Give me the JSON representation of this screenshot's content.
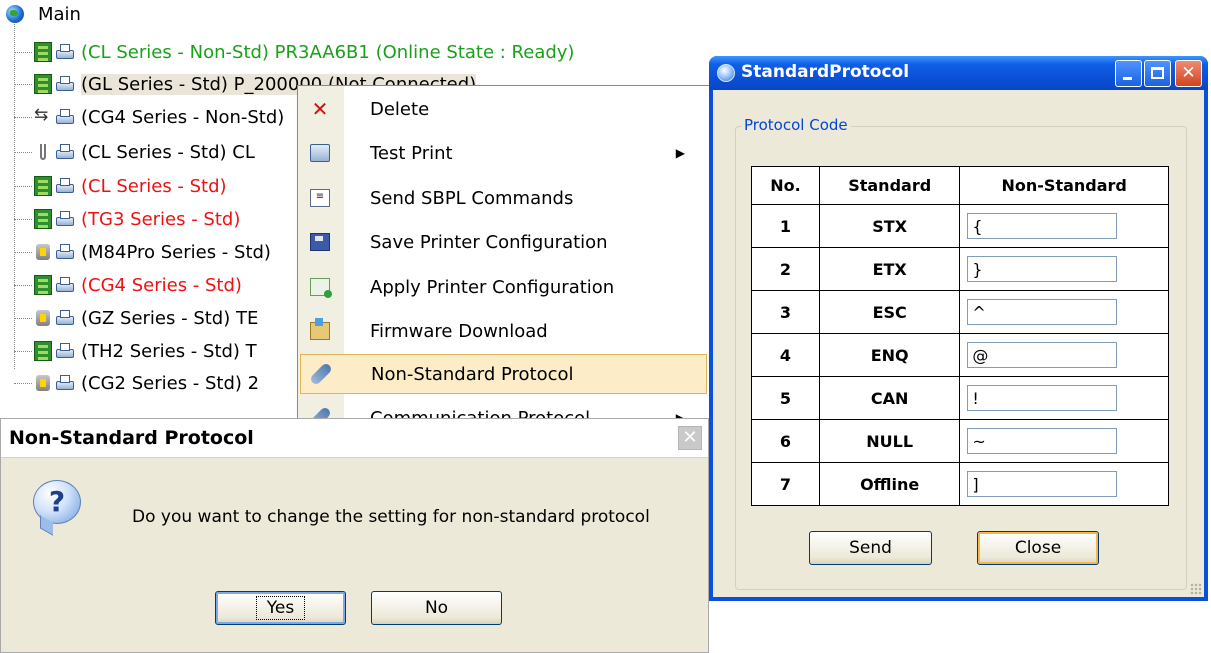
{
  "tree": {
    "root_label": "Main",
    "items": [
      {
        "label": "(CL Series - Non-Std) PR3AA6B1 (Online State : Ready)",
        "color": "#1aa01a",
        "icon": "board-connection-icon"
      },
      {
        "label": "(GL Series - Std) P_200000 (Not Connected)",
        "color": "#000000",
        "icon": "board-connection-icon",
        "selected": true
      },
      {
        "label": "(CG4 Series - Non-Std)",
        "color": "#000000",
        "icon": "usb-connection-icon"
      },
      {
        "label": "(CL Series - Std) CL",
        "color": "#000000",
        "icon": "lan-connection-icon"
      },
      {
        "label": "(CL Series - Std)",
        "color": "#ee1111",
        "icon": "board-connection-icon"
      },
      {
        "label": "(TG3 Series - Std)",
        "color": "#ee1111",
        "icon": "board-connection-icon"
      },
      {
        "label": "(M84Pro Series - Std)",
        "color": "#000000",
        "icon": "serial-connection-icon"
      },
      {
        "label": "(CG4 Series - Std)",
        "color": "#ee1111",
        "icon": "board-connection-icon"
      },
      {
        "label": "(GZ Series - Std) TE",
        "color": "#000000",
        "icon": "serial-connection-icon"
      },
      {
        "label": "(TH2 Series - Std) T",
        "color": "#000000",
        "icon": "board-connection-icon"
      },
      {
        "label": "(CG2 Series - Std) 2",
        "color": "#000000",
        "icon": "serial-connection-icon"
      }
    ]
  },
  "context_menu": {
    "items": [
      {
        "label": "Delete",
        "icon": "delete-icon"
      },
      {
        "label": "Test Print",
        "icon": "printer-icon",
        "submenu": true
      },
      {
        "label": "Send SBPL Commands",
        "icon": "sbpl-icon"
      },
      {
        "label": "Save Printer Configuration",
        "icon": "save-icon"
      },
      {
        "label": "Apply Printer Configuration",
        "icon": "apply-config-icon"
      },
      {
        "label": "Firmware Download",
        "icon": "firmware-icon"
      },
      {
        "label": "Non-Standard Protocol",
        "icon": "plug-icon",
        "highlighted": true
      },
      {
        "label": "Communication Protocol",
        "icon": "plug-icon",
        "submenu": true
      }
    ],
    "submenu_arrow": "▶"
  },
  "message_box": {
    "title": "Non-Standard Protocol",
    "close_glyph": "✕",
    "icon_glyph": "?",
    "message": "Do you want to change the setting for non-standard protocol",
    "yes_label": "Yes",
    "no_label": "No"
  },
  "protocol_window": {
    "title": "StandardProtocol",
    "group_label": "Protocol Code",
    "headers": {
      "no": "No.",
      "standard": "Standard",
      "non_standard": "Non-Standard"
    },
    "rows": [
      {
        "no": "1",
        "standard": "STX",
        "value": "{"
      },
      {
        "no": "2",
        "standard": "ETX",
        "value": "}"
      },
      {
        "no": "3",
        "standard": "ESC",
        "value": "^"
      },
      {
        "no": "4",
        "standard": "ENQ",
        "value": "@"
      },
      {
        "no": "5",
        "standard": "CAN",
        "value": "!"
      },
      {
        "no": "6",
        "standard": "NULL",
        "value": "~"
      },
      {
        "no": "7",
        "standard": "Offline",
        "value": "]"
      }
    ],
    "send_label": "Send",
    "close_label": "Close"
  }
}
